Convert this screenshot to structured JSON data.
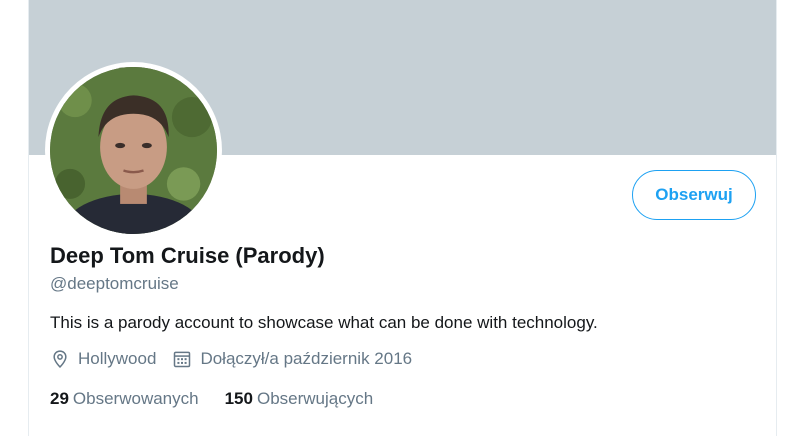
{
  "profile": {
    "display_name": "Deep Tom Cruise (Parody)",
    "handle": "@deeptomcruise",
    "bio": "This is a parody account to showcase what can be done with technology.",
    "location": "Hollywood",
    "joined": "Dołączył/a październik 2016",
    "follow_label": "Obserwuj"
  },
  "stats": {
    "following_count": "29",
    "following_label": "Obserwowanych",
    "followers_count": "150",
    "followers_label": "Obserwujących"
  },
  "icons": {
    "location": "map-pin-icon",
    "joined": "calendar-icon"
  },
  "colors": {
    "banner": "#c6d0d6",
    "accent": "#1da1f2",
    "secondary_text": "#657786",
    "primary_text": "#14171a"
  }
}
